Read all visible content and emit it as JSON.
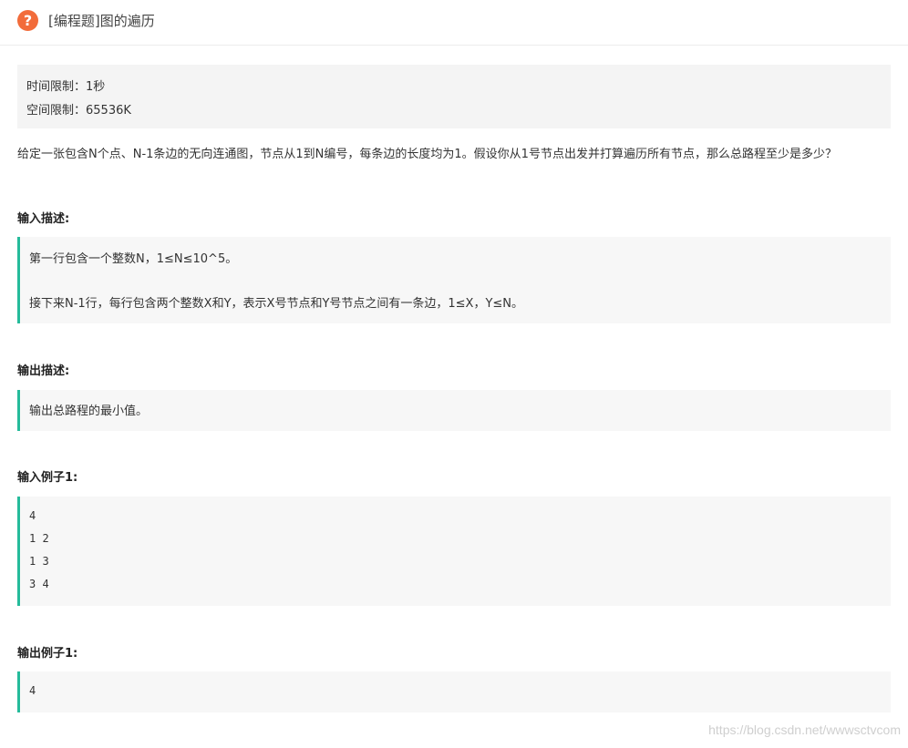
{
  "header": {
    "title": "[编程题]图的遍历"
  },
  "limits": {
    "time": "时间限制：1秒",
    "space": "空间限制：65536K"
  },
  "description": "给定一张包含N个点、N-1条边的无向连通图，节点从1到N编号，每条边的长度均为1。假设你从1号节点出发并打算遍历所有节点，那么总路程至少是多少？",
  "input_desc": {
    "heading": "输入描述:",
    "line1": "第一行包含一个整数N，1≤N≤10^5。",
    "line2": "接下来N-1行，每行包含两个整数X和Y，表示X号节点和Y号节点之间有一条边，1≤X，Y≤N。"
  },
  "output_desc": {
    "heading": "输出描述:",
    "line1": "输出总路程的最小值。"
  },
  "input_example": {
    "heading": "输入例子1:",
    "lines": [
      "4",
      "1 2",
      "1 3",
      "3 4"
    ]
  },
  "output_example": {
    "heading": "输出例子1:",
    "lines": [
      "4"
    ]
  },
  "watermark": "https://blog.csdn.net/wwwsctvcom",
  "colors": {
    "accent": "#25bb9b",
    "help_icon": "#f26c3b"
  }
}
